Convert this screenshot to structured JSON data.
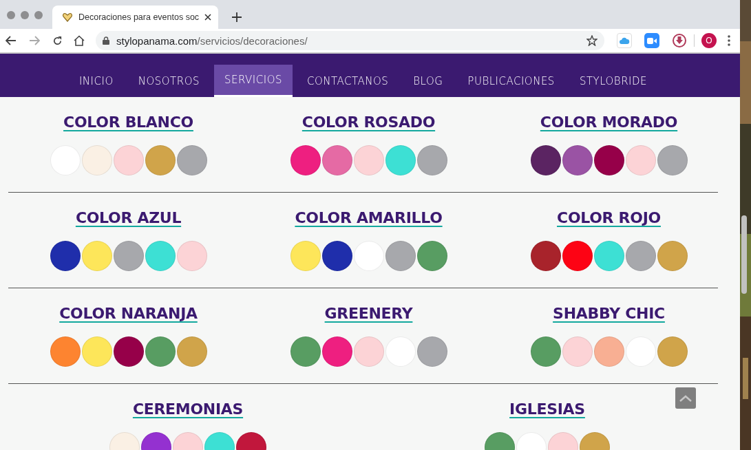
{
  "browser": {
    "tab": {
      "title": "Decoraciones para eventos soc",
      "selected": true
    },
    "url": {
      "host": "stylopanama.com",
      "path": "/servicios/decoraciones/"
    },
    "profile": "O"
  },
  "nav": [
    {
      "label": "INICIO",
      "selected": false
    },
    {
      "label": "NOSOTROS",
      "selected": false
    },
    {
      "label": "SERVICIOS",
      "selected": true
    },
    {
      "label": "CONTACTANOS",
      "selected": false
    },
    {
      "label": "BLOG",
      "selected": false
    },
    {
      "label": "PUBLICACIONES",
      "selected": false
    },
    {
      "label": "STYLOBRIDE",
      "selected": false
    }
  ],
  "sections": [
    {
      "title": "COLOR BLANCO",
      "swatches": [
        {
          "color": "#ffffff"
        },
        {
          "color": "#faf0e4"
        },
        {
          "color": "#fcd3d6"
        },
        {
          "color": "#d0a44a"
        },
        {
          "color": "#a7a8ac"
        }
      ]
    },
    {
      "title": "COLOR ROSADO",
      "swatches": [
        {
          "color": "#ee1f80"
        },
        {
          "color": "#e56aa4"
        },
        {
          "color": "#fcd3d6"
        },
        {
          "color": "#3de0d4"
        },
        {
          "color": "#a7a8ac"
        }
      ]
    },
    {
      "title": "COLOR MORADO",
      "swatches": [
        {
          "color": "#5b2462"
        },
        {
          "color": "#9a53a4"
        },
        {
          "color": "#960049"
        },
        {
          "color": "#fcd3d6"
        },
        {
          "color": "#a7a8ac"
        }
      ]
    },
    {
      "title": "COLOR AZUL",
      "swatches": [
        {
          "color": "#1f2eab"
        },
        {
          "color": "#fde65a"
        },
        {
          "color": "#a7a8ac"
        },
        {
          "color": "#3de0d4"
        },
        {
          "color": "#fcd3d6"
        }
      ]
    },
    {
      "title": "COLOR AMARILLO",
      "swatches": [
        {
          "color": "#fde65a"
        },
        {
          "color": "#1f2eab"
        },
        {
          "color": "#ffffff"
        },
        {
          "color": "#a7a8ac"
        },
        {
          "color": "#589d62"
        }
      ]
    },
    {
      "title": "COLOR ROJO",
      "swatches": [
        {
          "color": "#a8232b"
        },
        {
          "color": "#fd0314"
        },
        {
          "color": "#3de0d4"
        },
        {
          "color": "#a7a8ac"
        },
        {
          "color": "#d0a44a"
        }
      ]
    },
    {
      "title": "COLOR NARANJA",
      "swatches": [
        {
          "color": "#fd8430"
        },
        {
          "color": "#fde65a"
        },
        {
          "color": "#960049"
        },
        {
          "color": "#589d62"
        },
        {
          "color": "#d0a44a"
        }
      ]
    },
    {
      "title": "GREENERY",
      "swatches": [
        {
          "color": "#589d62"
        },
        {
          "color": "#ee1f80"
        },
        {
          "color": "#fcd3d6"
        },
        {
          "color": "#ffffff"
        },
        {
          "color": "#a7a8ac"
        }
      ]
    },
    {
      "title": "SHABBY CHIC",
      "swatches": [
        {
          "color": "#589d62"
        },
        {
          "color": "#fcd3d6"
        },
        {
          "color": "#f8af93"
        },
        {
          "color": "#ffffff"
        },
        {
          "color": "#d0a44a"
        }
      ]
    },
    {
      "title": "CEREMONIAS",
      "swatches": [
        {
          "color": "#faf0e4"
        },
        {
          "color": "#9431d0"
        },
        {
          "color": "#fcd3d6"
        },
        {
          "color": "#3de0d4"
        },
        {
          "color": "#c1173c"
        }
      ]
    },
    {
      "title": "IGLESIAS",
      "swatches": [
        {
          "color": "#589d62"
        },
        {
          "color": "#ffffff"
        },
        {
          "color": "#fcd3d6"
        },
        {
          "color": "#d0a44a"
        }
      ]
    }
  ]
}
